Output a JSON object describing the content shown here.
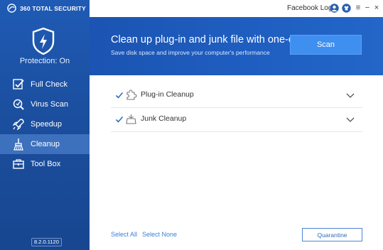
{
  "app": {
    "brand": "360 TOTAL SECURITY",
    "protection_status": "Protection: On",
    "version": "8.2.0.1120"
  },
  "titlebar": {
    "login_label": "Facebook Login",
    "icons": [
      "user-icon",
      "shirt-icon"
    ],
    "controls": {
      "menu": "≡",
      "minimize": "−",
      "close": "×"
    }
  },
  "sidebar": {
    "items": [
      {
        "label": "Full Check",
        "icon": "full-check-icon",
        "active": false
      },
      {
        "label": "Virus Scan",
        "icon": "virus-scan-icon",
        "active": false
      },
      {
        "label": "Speedup",
        "icon": "rocket-icon",
        "active": false
      },
      {
        "label": "Cleanup",
        "icon": "broom-icon",
        "active": true
      },
      {
        "label": "Tool Box",
        "icon": "toolbox-icon",
        "active": false
      }
    ]
  },
  "banner": {
    "title": "Clean up plug-in and junk file with one-click",
    "subtitle": "Save disk space and improve your computer's performance",
    "scan_label": "Scan"
  },
  "list": {
    "items": [
      {
        "label": "Plug-in Cleanup",
        "checked": true,
        "icon": "puzzle-icon"
      },
      {
        "label": "Junk Cleanup",
        "checked": true,
        "icon": "junk-icon"
      }
    ]
  },
  "footer": {
    "select_all": "Select All",
    "select_none": "Select None",
    "quarantine": "Quarantine"
  },
  "colors": {
    "sidebar": "#1b4f9f",
    "sidebar_active": "#3d70bd",
    "banner": "#1f5fc2",
    "scan_button": "#3f8ff0",
    "link": "#3a7fd6"
  }
}
